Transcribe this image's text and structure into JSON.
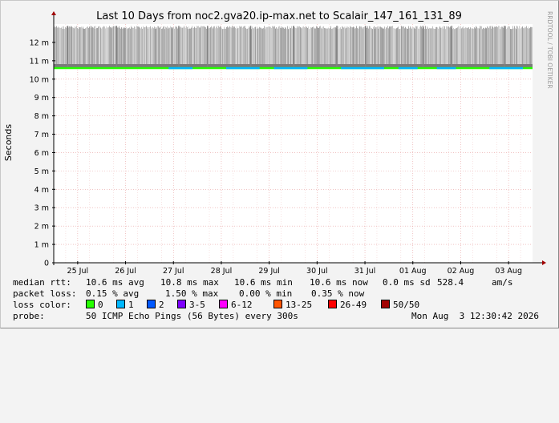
{
  "watermark": "RRDTOOL / TOBI OETIKER",
  "chart_data": {
    "type": "area",
    "title": "Last 10 Days from noc2.gva20.ip-max.net to Scalair_147_161_131_89",
    "ylabel": "Seconds",
    "ylim": [
      0,
      0.013
    ],
    "y_ticks": [
      0,
      0.001,
      0.002,
      0.003,
      0.004,
      0.005,
      0.006,
      0.007,
      0.008,
      0.009,
      0.01,
      0.011,
      0.012
    ],
    "y_tick_labels": [
      "0",
      "1 m",
      "2 m",
      "3 m",
      "4 m",
      "5 m",
      "6 m",
      "7 m",
      "8 m",
      "9 m",
      "10 m",
      "11 m",
      "12 m"
    ],
    "x_range": [
      0,
      10
    ],
    "x_ticks": [
      0.5,
      1.5,
      2.5,
      3.5,
      4.5,
      5.5,
      6.5,
      7.5,
      8.5,
      9.5
    ],
    "x_tick_labels": [
      "25 Jul",
      "26 Jul",
      "27 Jul",
      "28 Jul",
      "29 Jul",
      "30 Jul",
      "31 Jul",
      "01 Aug",
      "02 Aug",
      "03 Aug"
    ],
    "grid": true,
    "median_rtt_s": 0.0106,
    "smoke_top_s": 0.0129,
    "series": [
      {
        "name": "median rtt",
        "values": [
          0.0106,
          0.0106,
          0.0106,
          0.0106,
          0.0106,
          0.0106,
          0.0106,
          0.0106,
          0.0106,
          0.0106,
          0.0106
        ]
      }
    ]
  },
  "stats": {
    "median_rtt": {
      "label": "median rtt:",
      "avg": "10.6 ms avg",
      "max": "10.8 ms max",
      "min": "10.6 ms min",
      "now": "10.6 ms now",
      "sd": "0.0 ms sd",
      "am": "528.4",
      "am_unit": "am/s"
    },
    "packet_loss": {
      "label": "packet loss:",
      "avg": "0.15 % avg",
      "max": "1.50 % max",
      "min": "0.00 % min",
      "now": "0.35 % now"
    },
    "loss_color": {
      "label": "loss color:",
      "items": [
        {
          "label": "0",
          "color": "#26ff00"
        },
        {
          "label": "1",
          "color": "#00b8ff"
        },
        {
          "label": "2",
          "color": "#0059ff"
        },
        {
          "label": "3-5",
          "color": "#7e00ff"
        },
        {
          "label": "6-12",
          "color": "#ff00ff"
        },
        {
          "label": "13-25",
          "color": "#ff5500"
        },
        {
          "label": "26-49",
          "color": "#ff0000"
        },
        {
          "label": "50/50",
          "color": "#a10000"
        }
      ]
    },
    "probe": {
      "label": "probe:",
      "desc": "50 ICMP Echo Pings (56 Bytes) every 300s",
      "timestamp": "Mon Aug  3 12:30:42 2026"
    }
  }
}
